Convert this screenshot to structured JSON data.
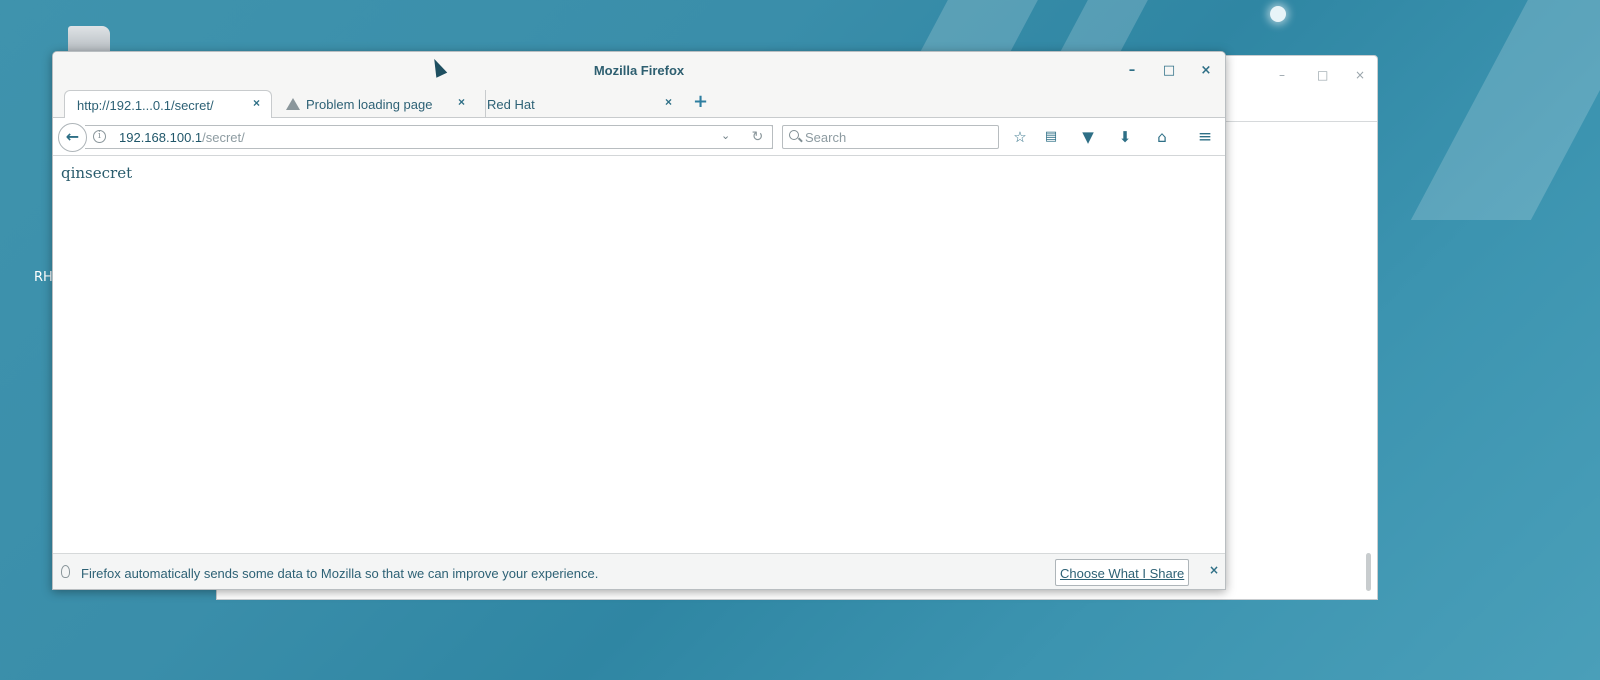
{
  "desktop": {
    "label_partial": "RH"
  },
  "window": {
    "title": "Mozilla Firefox",
    "controls": {
      "minimize": "–",
      "maximize": "□",
      "close": "×"
    }
  },
  "tabs": [
    {
      "label": "http://192.1...0.1/secret/",
      "active": true,
      "icon": "none",
      "close": "×"
    },
    {
      "label": "Problem loading page",
      "active": false,
      "icon": "warning-icon",
      "close": "×"
    },
    {
      "label": "Red Hat",
      "active": false,
      "icon": "none",
      "close": "×"
    }
  ],
  "newtab_symbol": "+",
  "navbar": {
    "url_host": "192.168.100.1",
    "url_path": "/secret/",
    "search_placeholder": "Search",
    "icons": [
      "back-arrow-icon",
      "info-icon",
      "dropdown-icon",
      "reload-icon",
      "bookmark-star-icon",
      "reading-list-icon",
      "pocket-icon",
      "download-icon",
      "home-icon",
      "menu-icon"
    ]
  },
  "page": {
    "body_text": "qinsecret"
  },
  "notification": {
    "message": "Firefox automatically sends some data to Mozilla so that we can improve your experience.",
    "button_label": "Choose What I Share",
    "close": "×"
  },
  "background_window": {
    "controls": {
      "minimize": "–",
      "maximize": "□",
      "close": "×"
    }
  },
  "colors": {
    "desktop_bg": "#3a8eaa",
    "accent": "#2e6f86",
    "text": "#2d6175"
  }
}
